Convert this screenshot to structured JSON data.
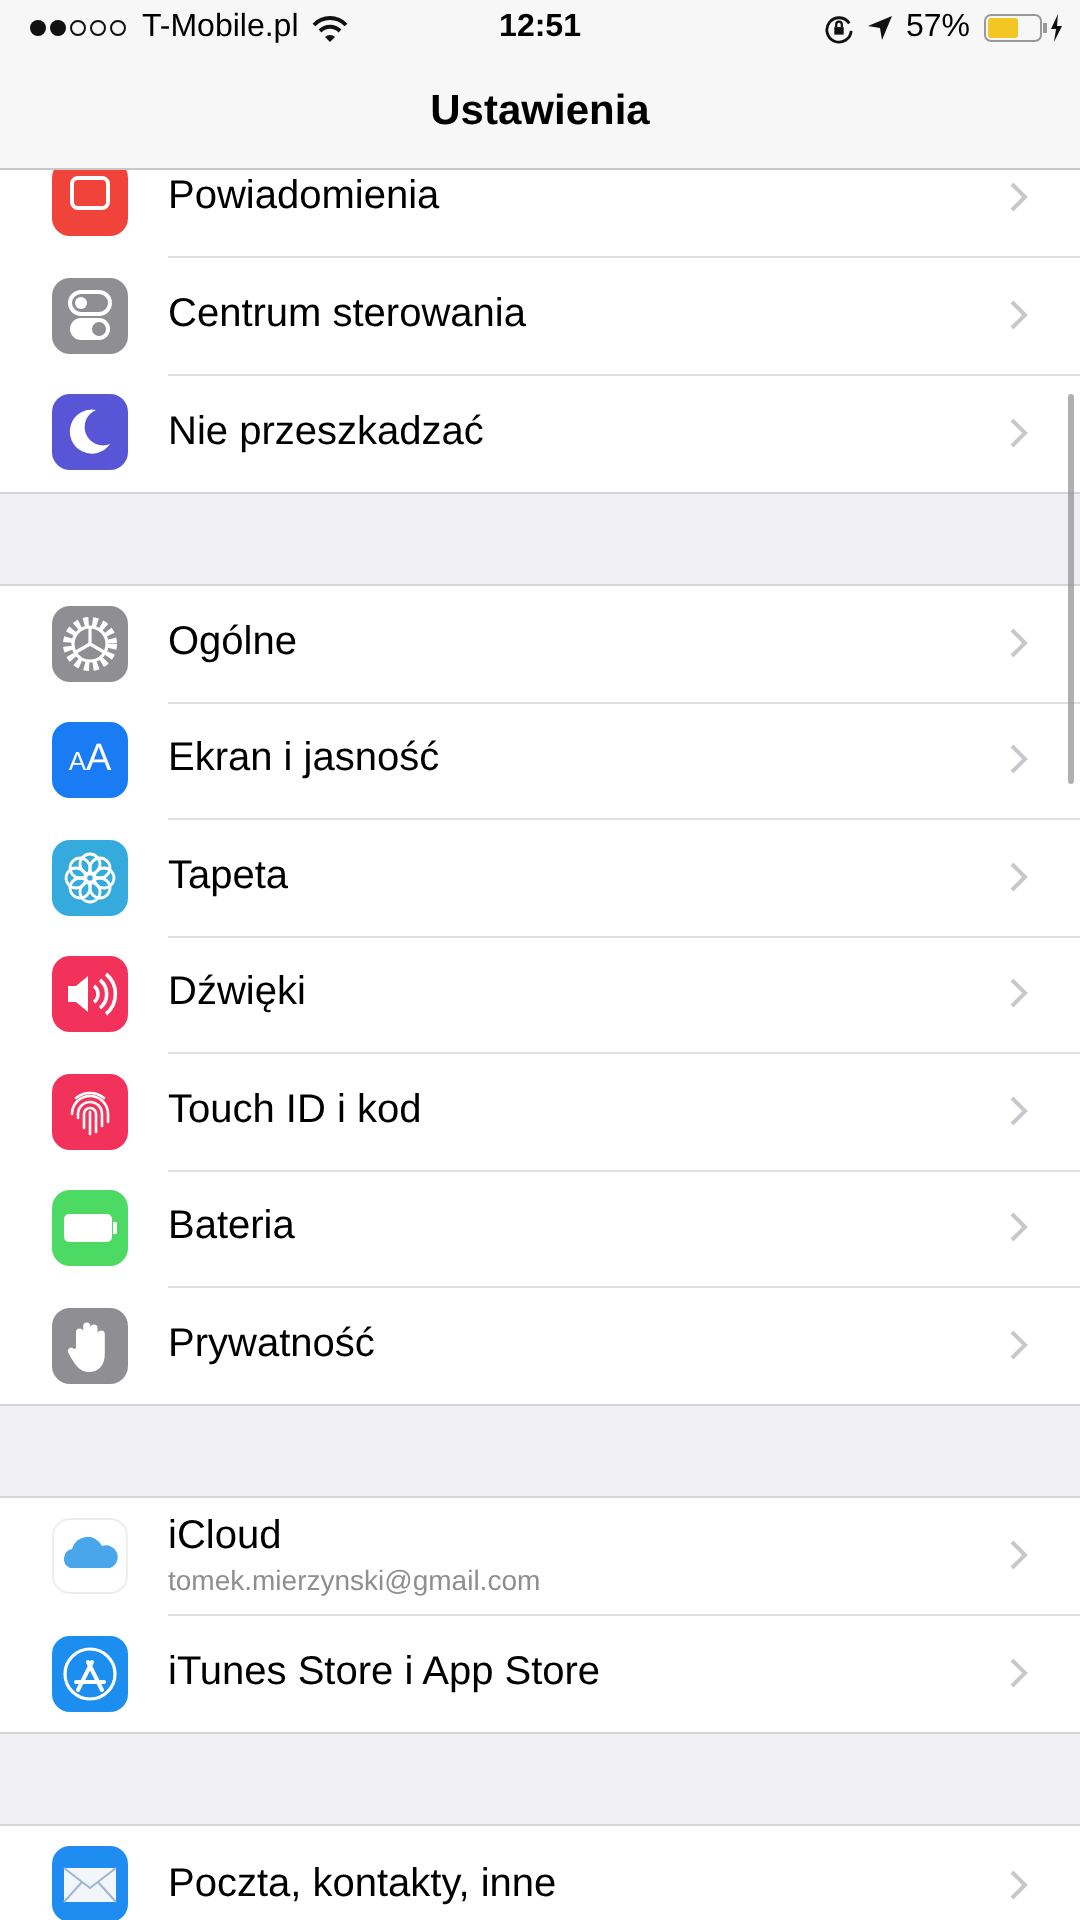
{
  "status_bar": {
    "carrier": "T-Mobile.pl",
    "time": "12:51",
    "battery": "57%"
  },
  "nav_bar": {
    "title": "Ustawienia"
  },
  "sections": [
    {
      "rows": [
        {
          "label": "Powiadomienia",
          "color": "#f0433a"
        },
        {
          "label": "Centrum sterowania",
          "color": "#8e8e93"
        },
        {
          "label": "Nie przeszkadzać",
          "color": "#5856d6"
        }
      ]
    },
    {
      "rows": [
        {
          "label": "Ogólne",
          "color": "#8e8e93"
        },
        {
          "label": "Ekran i jasność",
          "color": "#1a7cf5",
          "icon_text": "AA"
        },
        {
          "label": "Tapeta",
          "color": "#35aadc"
        },
        {
          "label": "Dźwięki",
          "color": "#f2325a"
        },
        {
          "label": "Touch ID i kod",
          "color": "#f2325a"
        },
        {
          "label": "Bateria",
          "color": "#4cd964"
        },
        {
          "label": "Prywatność",
          "color": "#8e8e93"
        }
      ]
    },
    {
      "rows": [
        {
          "label": "iCloud",
          "subtitle": "tomek.mierzynski@gmail.com",
          "color": "#ffffff"
        },
        {
          "label": "iTunes Store i App Store",
          "color": "#1c8ef0"
        }
      ]
    },
    {
      "rows": [
        {
          "label": "Poczta, kontakty, inne",
          "color": "#1e8cf0"
        }
      ]
    }
  ]
}
